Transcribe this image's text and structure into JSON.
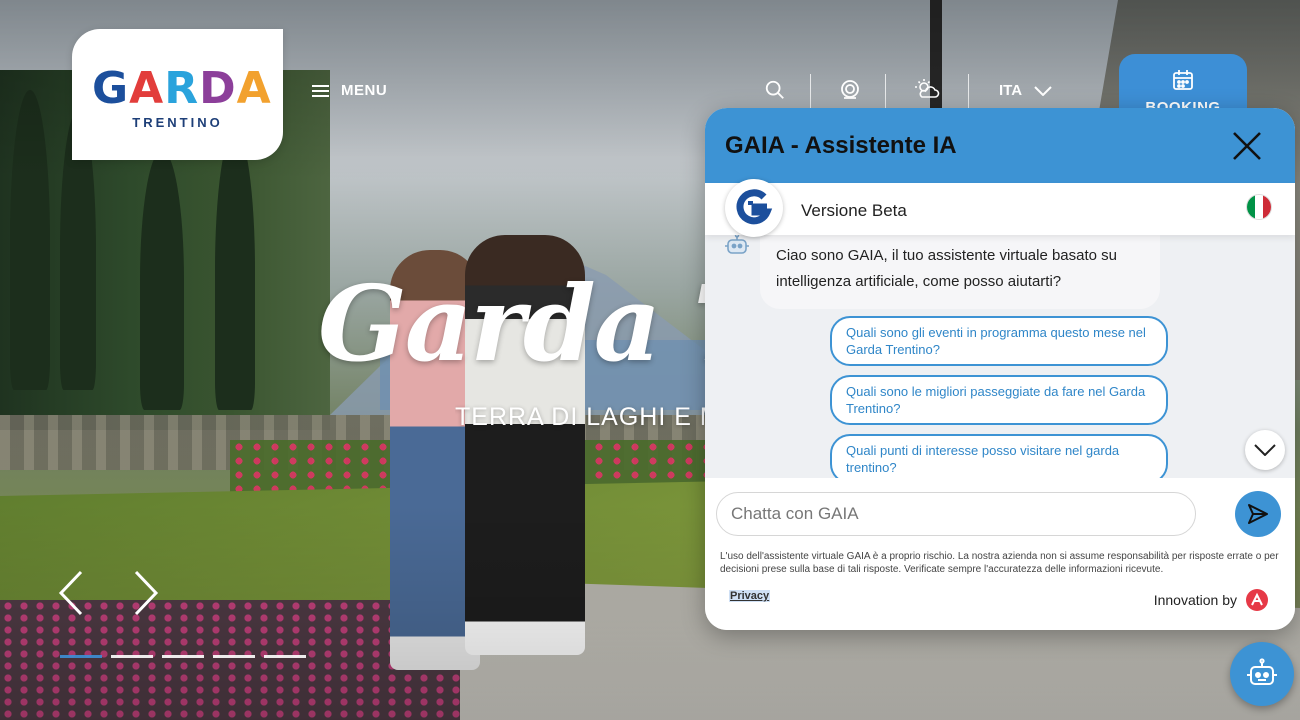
{
  "header": {
    "logo": {
      "word": [
        "G",
        "A",
        "R",
        "D",
        "A"
      ],
      "sub": "TRENTINO"
    },
    "menu_label": "MENU",
    "language": "ITA",
    "booking_label": "BOOKING",
    "icons": [
      "search-icon",
      "webcam-icon",
      "weather-icon",
      "chevron-down-icon",
      "calendar-icon"
    ]
  },
  "hero": {
    "title": "Garda Trentino",
    "subtitle": "TERRA DI LAGHI E MONTAGNE",
    "slides": 5,
    "active_slide": 1
  },
  "chat": {
    "title": "GAIA - Assistente IA",
    "version_label": "Versione Beta",
    "greeting": "Ciao sono GAIA, il tuo assistente virtuale basato su intelligenza artificiale, come posso aiutarti?",
    "suggestions": [
      "Quali sono gli eventi in programma questo mese nel Garda Trentino?",
      "Quali sono le migliori passeggiate da fare nel Garda Trentino?",
      "Quali punti di interesse posso visitare nel garda trentino?"
    ],
    "input_placeholder": "Chatta con GAIA",
    "disclaimer": "L'uso dell'assistente virtuale GAIA è a proprio rischio. La nostra azienda non si assume responsabilità per risposte errate o per decisioni prese sulla base di tali risposte. Verificate sempre l'accuratezza delle informazioni ricevute.",
    "privacy_label": "Privacy",
    "innovation_label": "Innovation by"
  },
  "colors": {
    "accent": "#3d93d4",
    "booking": "#3d8fd6",
    "logo_blue": "#1c4f9c"
  }
}
